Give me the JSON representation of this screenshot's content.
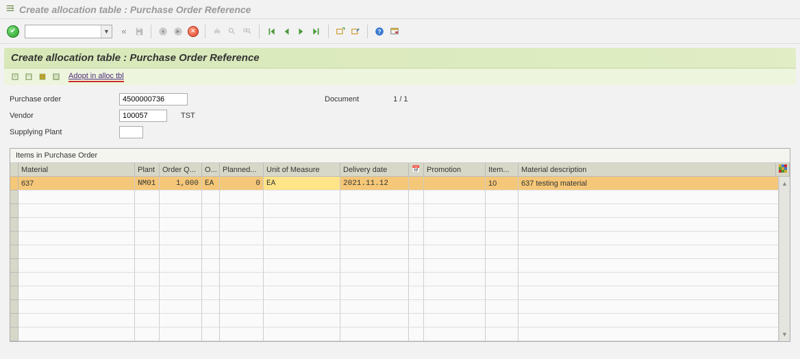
{
  "window": {
    "title": "Create allocation table : Purchase Order Reference"
  },
  "app_toolbar": {
    "combo_value": ""
  },
  "panel": {
    "header": "Create allocation table : Purchase Order Reference",
    "adopt_label": "Adopt in alloc tbl"
  },
  "form": {
    "po_label": "Purchase order",
    "po_value": "4500000736",
    "vendor_label": "Vendor",
    "vendor_value": "100057",
    "vendor_name": "TST",
    "plant_label": "Supplying Plant",
    "plant_value": "",
    "doc_label": "Document",
    "doc_value": "1  /  1"
  },
  "grid": {
    "title": "Items in Purchase Order",
    "columns": {
      "material": "Material",
      "plant": "Plant",
      "order_qty": "Order Q...",
      "order_uom": "O...",
      "planned": "Planned...",
      "uom": "Unit of Measure",
      "delivery": "Delivery date",
      "promotion": "Promotion",
      "item": "Item...",
      "desc": "Material description"
    },
    "rows": [
      {
        "material": "637",
        "plant": "NM01",
        "order_qty": "1,000",
        "order_uom": "EA",
        "planned": "0",
        "uom": "EA",
        "delivery": "2021.11.12",
        "promotion": "",
        "item": "10",
        "desc": "637 testing material"
      }
    ]
  }
}
